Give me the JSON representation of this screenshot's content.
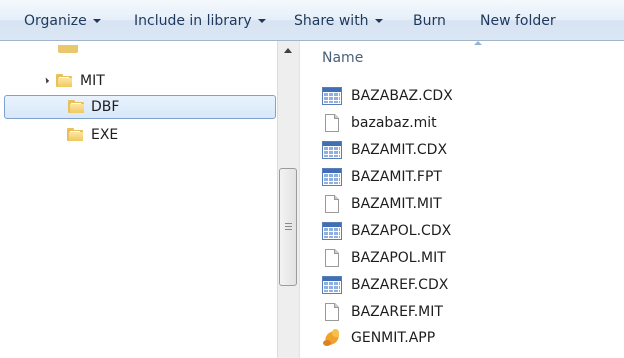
{
  "toolbar": {
    "organize": "Organize",
    "include_in_library": "Include in library",
    "share_with": "Share with",
    "burn": "Burn",
    "new_folder": "New folder"
  },
  "nav": {
    "items": [
      {
        "label": "MIT",
        "expanded": true
      },
      {
        "label": "DBF",
        "selected": true
      },
      {
        "label": "EXE"
      }
    ]
  },
  "files": {
    "column_name": "Name",
    "rows": [
      {
        "name": "BAZABAZ.CDX",
        "icon": "index-file-icon"
      },
      {
        "name": "bazabaz.mit",
        "icon": "blank-file-icon"
      },
      {
        "name": "BAZAMIT.CDX",
        "icon": "index-file-icon"
      },
      {
        "name": "BAZAMIT.FPT",
        "icon": "index-file-icon"
      },
      {
        "name": "BAZAMIT.MIT",
        "icon": "blank-file-icon"
      },
      {
        "name": "BAZAPOL.CDX",
        "icon": "index-file-icon"
      },
      {
        "name": "BAZAPOL.MIT",
        "icon": "blank-file-icon"
      },
      {
        "name": "BAZAREF.CDX",
        "icon": "index-file-icon"
      },
      {
        "name": "BAZAREF.MIT",
        "icon": "blank-file-icon"
      },
      {
        "name": "GENMIT.APP",
        "icon": "app-file-icon"
      }
    ]
  },
  "colors": {
    "toolbar_text": "#1e395b",
    "selection_border": "#7da2ce",
    "folder": "#e9c15b"
  }
}
